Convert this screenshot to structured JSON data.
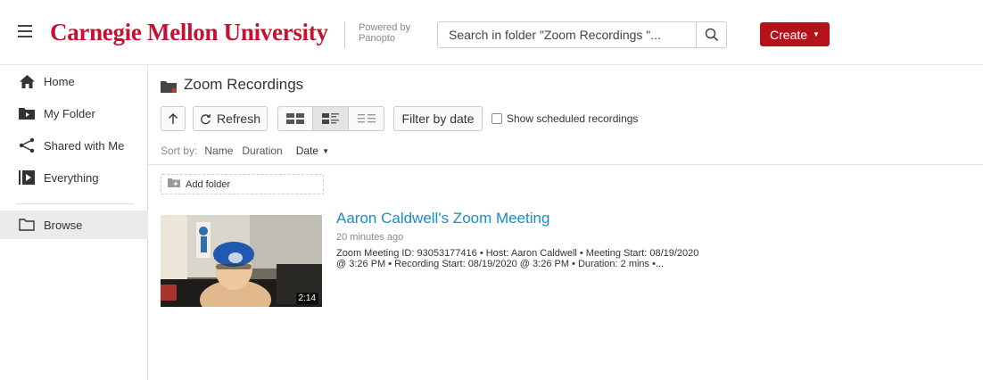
{
  "header": {
    "brand": "Carnegie Mellon University",
    "powered_line1": "Powered by",
    "powered_line2": "Panopto",
    "search_placeholder": "Search in folder \"Zoom Recordings \"...",
    "create_label": "Create",
    "brand_color": "#c41230",
    "create_color": "#b5121b"
  },
  "sidebar": {
    "items": [
      {
        "label": "Home",
        "icon": "home-icon"
      },
      {
        "label": "My Folder",
        "icon": "folder-video-icon"
      },
      {
        "label": "Shared with Me",
        "icon": "share-icon"
      },
      {
        "label": "Everything",
        "icon": "play-box-icon"
      },
      {
        "label": "Browse",
        "icon": "folder-outline-icon"
      }
    ],
    "active": "Browse"
  },
  "main": {
    "folder_title": "Zoom Recordings",
    "toolbar": {
      "refresh_label": "Refresh",
      "filter_label": "Filter by date",
      "show_scheduled_label": "Show scheduled recordings"
    },
    "sort": {
      "label": "Sort by:",
      "options": [
        "Name",
        "Duration",
        "Date"
      ],
      "active": "Date"
    },
    "add_folder_label": "Add folder",
    "sessions": [
      {
        "title": "Aaron Caldwell's Zoom Meeting",
        "age": "20 minutes ago",
        "description_line1": "Zoom Meeting ID: 93053177416  • Host: Aaron Caldwell  • Meeting Start: 08/19/2020",
        "description_line2": "@ 3:26 PM  • Recording Start: 08/19/2020 @ 3:26 PM  • Duration: 2 mins  •...",
        "duration": "2:14",
        "title_color": "#1a8bc9"
      }
    ]
  }
}
